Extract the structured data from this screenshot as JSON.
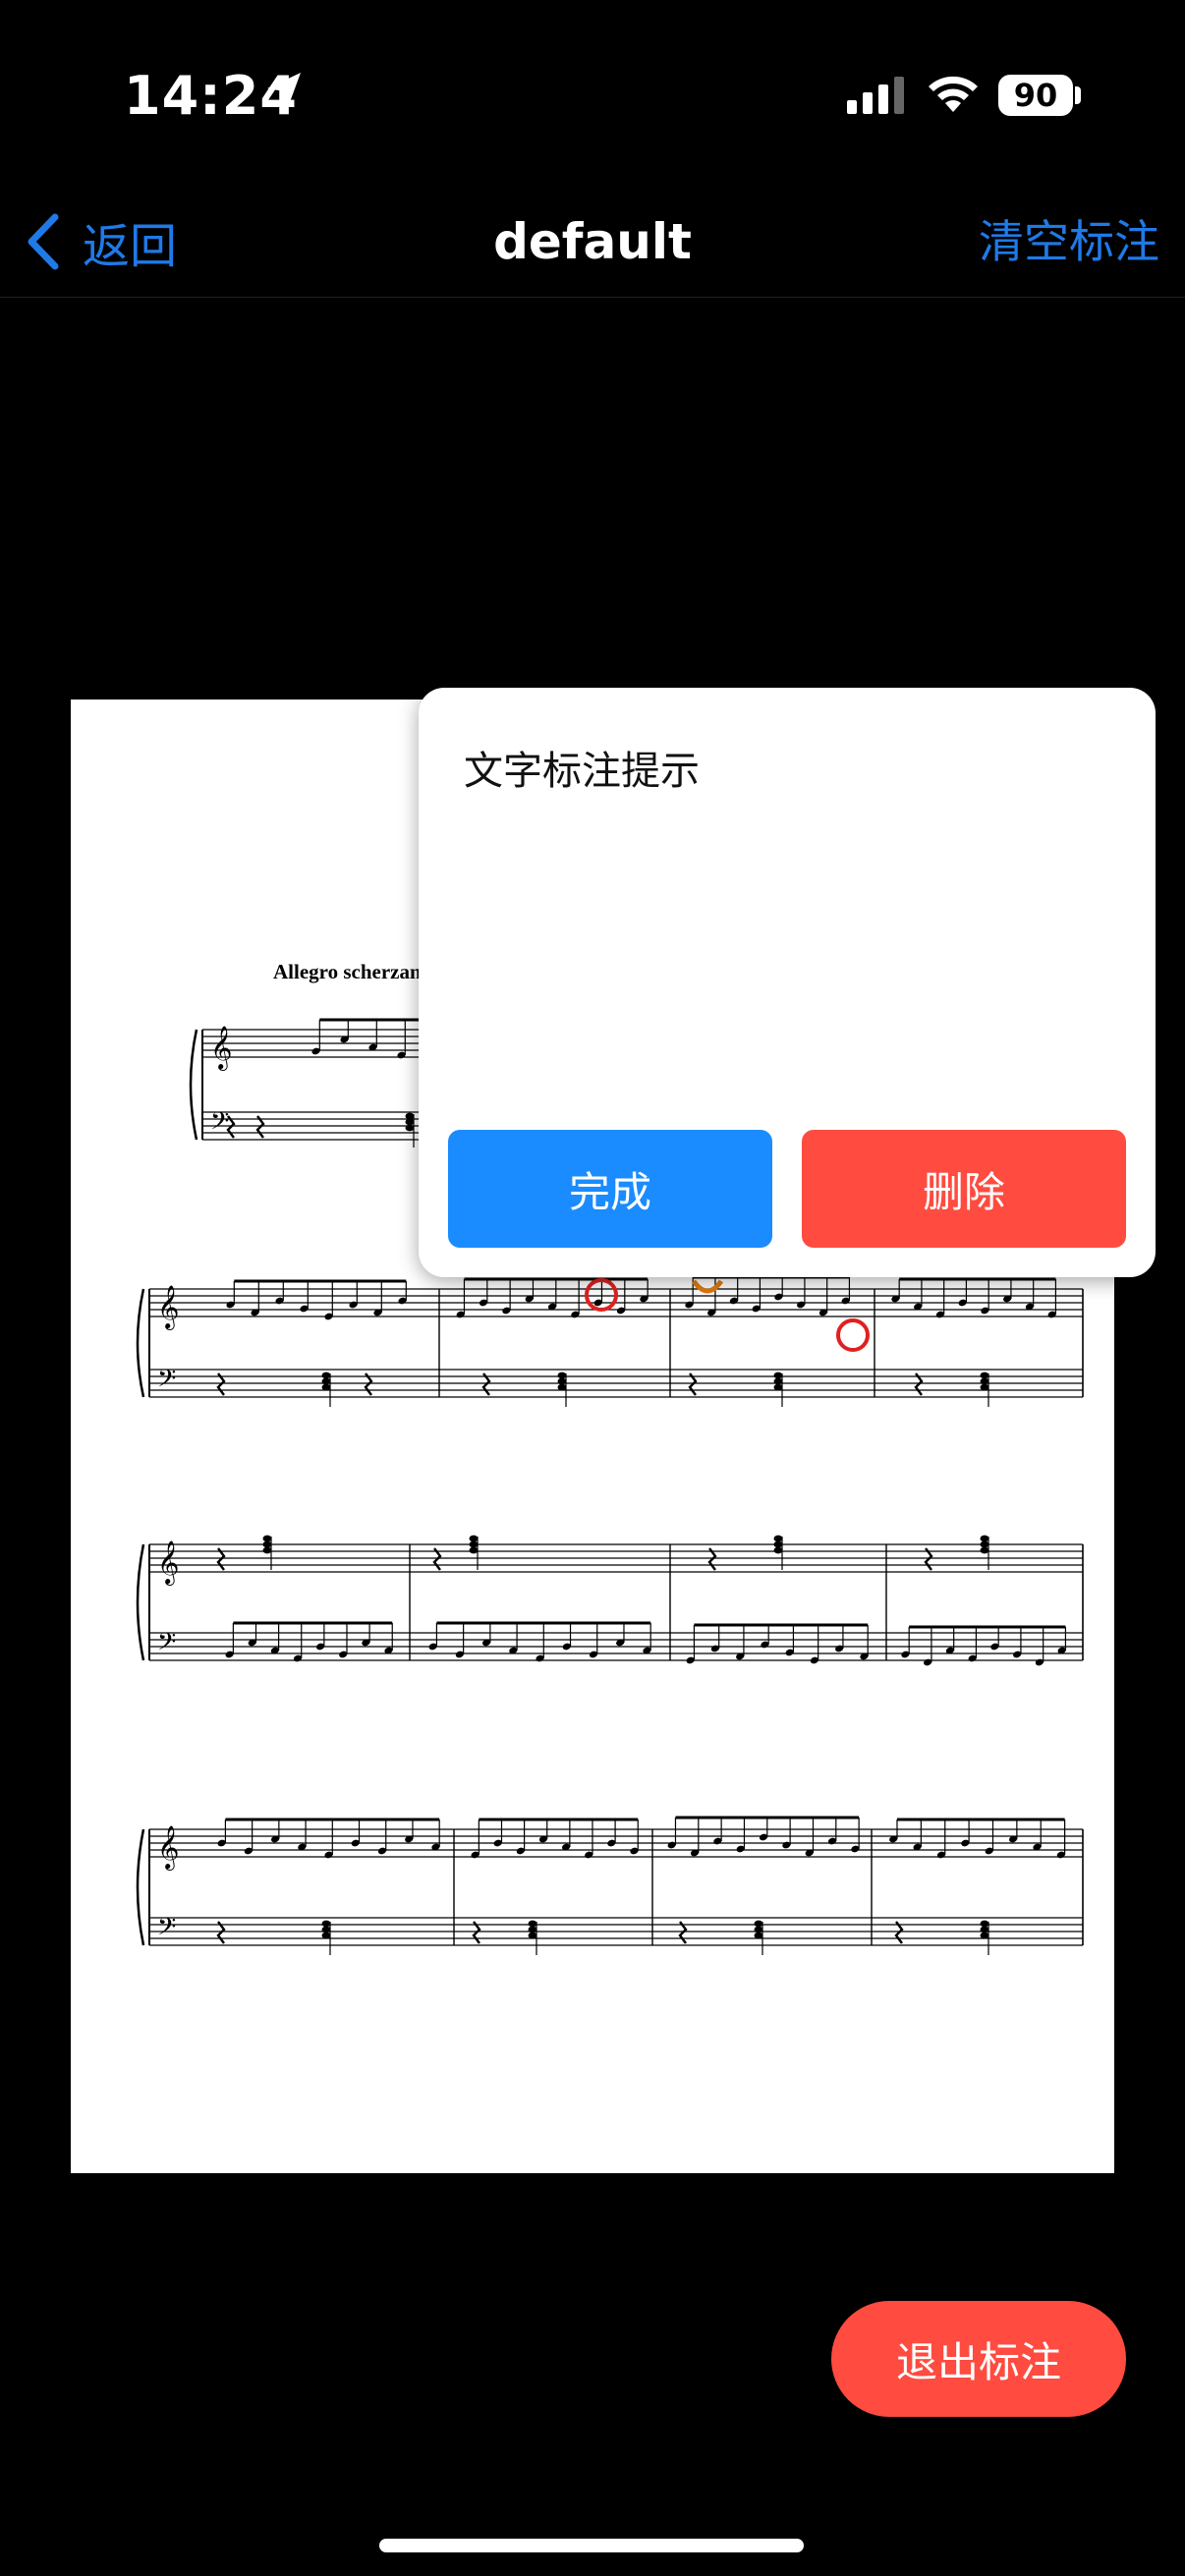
{
  "status_bar": {
    "time": "14:24",
    "battery": "90"
  },
  "nav": {
    "back_label": "返回",
    "title": "default",
    "clear_label": "清空标注"
  },
  "score": {
    "tempo_text": "Allegro scherzando"
  },
  "popup": {
    "hint": "文字标注提示",
    "done_label": "完成",
    "delete_label": "删除"
  },
  "exit_label": "退出标注",
  "colors": {
    "accent": "#1f7ae8",
    "done_button": "#1a8cff",
    "danger": "#ff4b40",
    "marker_red": "#e02020",
    "marker_orange": "#e07a10"
  },
  "icons": {
    "back": "chevron-left-icon",
    "location": "location-arrow-icon",
    "signal": "cellular-signal-icon",
    "wifi": "wifi-icon"
  }
}
